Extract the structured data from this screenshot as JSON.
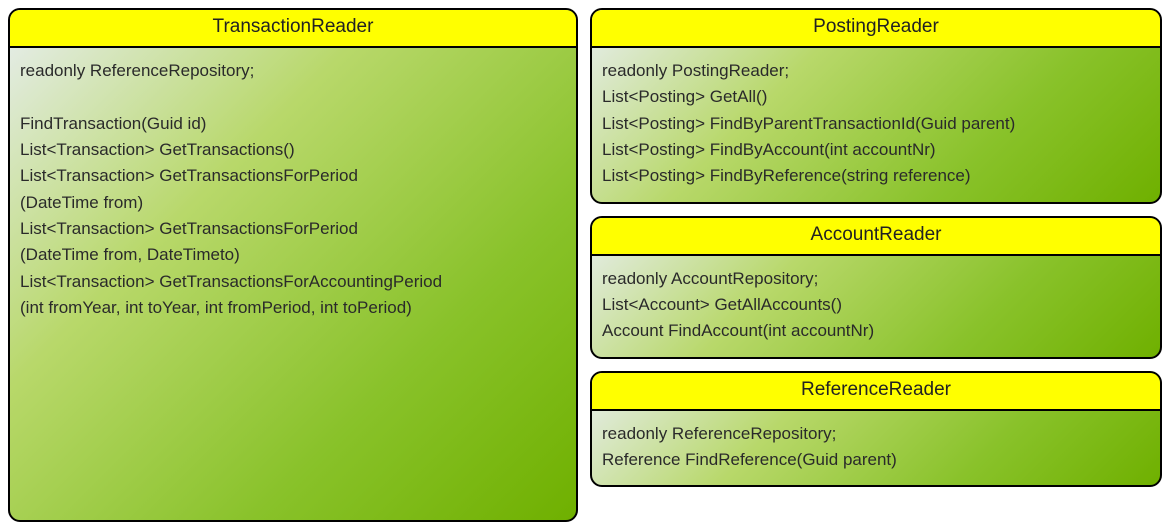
{
  "classes": {
    "transactionReader": {
      "title": "TransactionReader",
      "body": "readonly ReferenceRepository;\n\nFindTransaction(Guid id)\nList<Transaction> GetTransactions()\nList<Transaction> GetTransactionsForPeriod\n(DateTime from)\nList<Transaction> GetTransactionsForPeriod\n(DateTime from, DateTimeto)\nList<Transaction> GetTransactionsForAccountingPeriod\n(int fromYear, int toYear, int fromPeriod, int toPeriod)"
    },
    "postingReader": {
      "title": "PostingReader",
      "body": "readonly PostingReader;\nList<Posting> GetAll()\nList<Posting> FindByParentTransactionId(Guid parent)\nList<Posting> FindByAccount(int accountNr)\nList<Posting> FindByReference(string reference)"
    },
    "accountReader": {
      "title": "AccountReader",
      "body": "readonly AccountRepository;\nList<Account> GetAllAccounts()\nAccount FindAccount(int accountNr)"
    },
    "referenceReader": {
      "title": "ReferenceReader",
      "body": "readonly ReferenceRepository;\nReference FindReference(Guid parent)"
    }
  }
}
